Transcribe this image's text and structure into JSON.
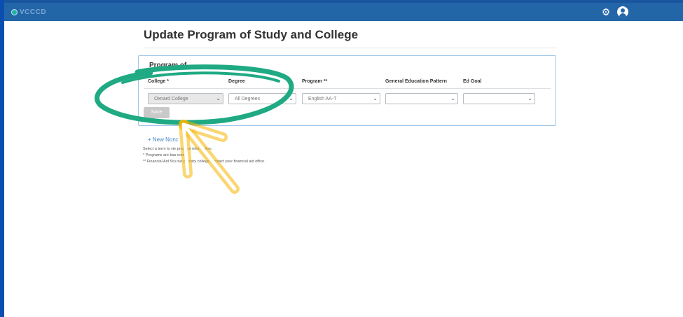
{
  "header": {
    "logo_text": "VCCCD",
    "settings_icon": "gear-icon",
    "user_icon": "user-icon"
  },
  "page": {
    "title": "Update Program of Study and College"
  },
  "panel": {
    "title": "Program of",
    "columns": {
      "college": "College *",
      "degree": "Degree",
      "program": "Program **",
      "gen_ed": "General Education Pattern",
      "ed_goal": "Ed Goal"
    },
    "fields": {
      "college_value": "Oxnard College",
      "degree_value": "All Degrees",
      "program_value": "English AA-T",
      "gen_ed_value": "",
      "ed_goal_value": ""
    },
    "save_label": "Save"
  },
  "links": {
    "new_noncredit": "+ New Nonc"
  },
  "notes": [
    "Select a term to vie                      prog am information.",
    "* Programs are bas                      ected.",
    "** Financial Aid Stu               our primary college, contact your financial aid office."
  ],
  "colors": {
    "header_bg": "#2366a8",
    "page_border": "#0a4fb0",
    "panel_border": "#9fc6e8",
    "annotation_circle": "#1faa83",
    "annotation_arrow": "#f2a400"
  }
}
